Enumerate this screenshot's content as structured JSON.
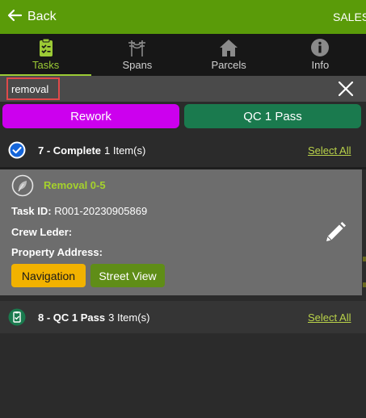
{
  "header": {
    "back_label": "Back",
    "back_icon": "arrow-left-icon",
    "title": "SALES",
    "bg_color": "#5a9b09"
  },
  "tabs": [
    {
      "label": "Tasks",
      "icon": "clipboard-check-icon",
      "active": true
    },
    {
      "label": "Spans",
      "icon": "utility-pole-icon",
      "active": false
    },
    {
      "label": "Parcels",
      "icon": "house-icon",
      "active": false
    },
    {
      "label": "Info",
      "icon": "info-icon",
      "active": false
    }
  ],
  "search": {
    "value": "removal",
    "placeholder": "",
    "clear_icon": "close-icon"
  },
  "filters": [
    {
      "label": "Rework",
      "color": "#cc00ee"
    },
    {
      "label": "QC 1 Pass",
      "color": "#1a7a4e"
    }
  ],
  "groups": [
    {
      "title": "7 - Complete",
      "count_text": "1 Item(s)",
      "select_all": "Select All",
      "icon": "check-circle-icon",
      "tasks": [
        {
          "name": "Removal 0-5",
          "icon": "leaf-icon",
          "task_id_label": "Task ID:",
          "task_id": "R001-20230905869",
          "crew_label": "Crew Leder:",
          "crew": "",
          "address_label": "Property Address:",
          "address": "",
          "navigation_label": "Navigation",
          "street_view_label": "Street View",
          "edit_icon": "pencil-icon"
        }
      ]
    },
    {
      "title": "8 - QC 1 Pass",
      "count_text": "3 Item(s)",
      "select_all": "Select All",
      "icon": "clipboard-check-icon"
    }
  ],
  "accent_colors": {
    "tab_active": "#9ccb35",
    "select_all": "#b9d24a",
    "task_name": "#a5d22c",
    "navigation_button": "#f2b200",
    "street_view_button": "#5f8d17"
  }
}
